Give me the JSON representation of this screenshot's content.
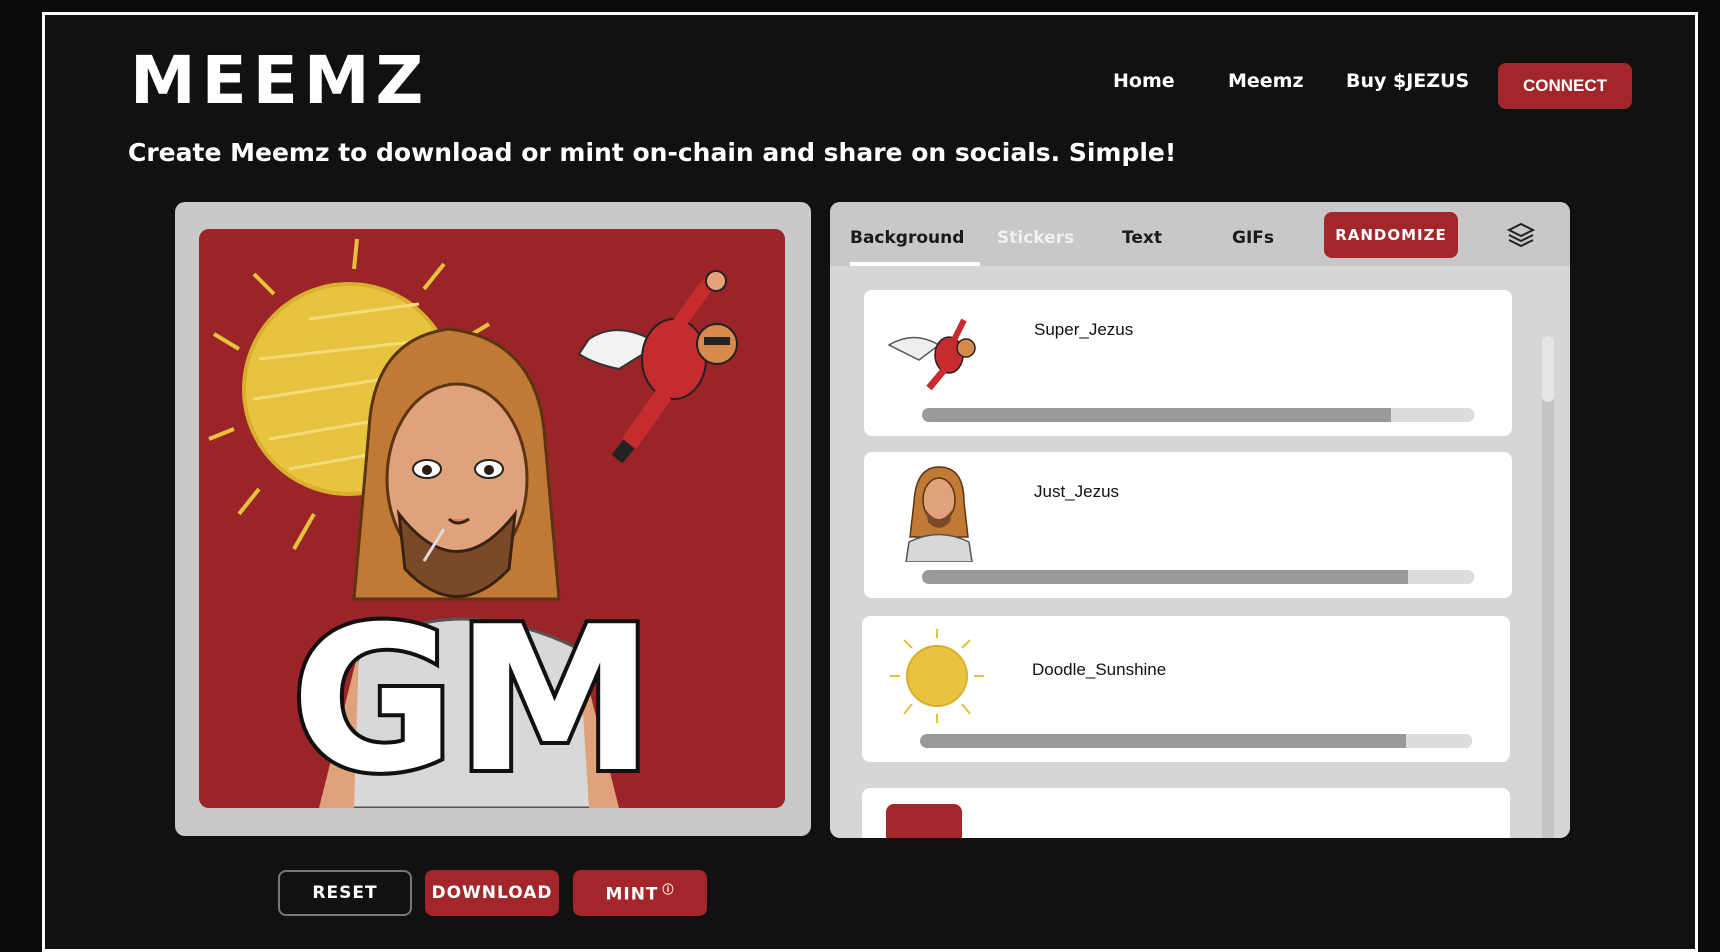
{
  "header": {
    "logo": "MEEMZ",
    "nav": [
      "Home",
      "Meemz",
      "Buy $JEZUS"
    ],
    "connect_label": "CONNECT"
  },
  "tagline": "Create Meemz to download or mint on-chain and share on socials. Simple!",
  "preview": {
    "overlay_text": "GM"
  },
  "editor": {
    "tabs": [
      "Background",
      "Stickers",
      "Text",
      "GIFs"
    ],
    "active_tab": "Background",
    "randomize_label": "RANDOMIZE",
    "items": [
      {
        "name": "Super_Jezus",
        "slider_value": 0.85
      },
      {
        "name": "Just_Jezus",
        "slider_value": 0.88
      },
      {
        "name": "Doodle_Sunshine",
        "slider_value": 0.88
      }
    ]
  },
  "actions": {
    "reset_label": "RESET",
    "download_label": "DOWNLOAD",
    "mint_label": "MINT",
    "mint_info": "ⓘ"
  },
  "colors": {
    "accent": "#a3262a",
    "canvas_bg": "#9b2428",
    "sun": "#e6c23a"
  }
}
